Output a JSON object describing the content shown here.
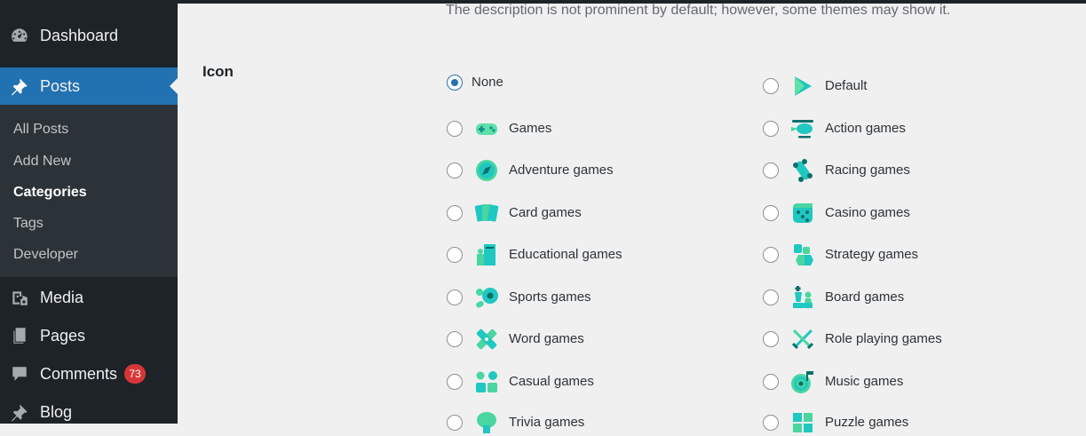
{
  "sidebar": {
    "dashboard": "Dashboard",
    "posts": "Posts",
    "submenu": [
      "All Posts",
      "Add New",
      "Categories",
      "Tags",
      "Developer"
    ],
    "media": "Media",
    "pages": "Pages",
    "comments": "Comments",
    "comments_count": "73",
    "blog": "Blog",
    "icons": {
      "dashboard": "gauge-icon",
      "posts": "pushpin-icon",
      "media": "media-icon",
      "pages": "pages-icon",
      "comments": "speech-bubble-icon",
      "blog": "pushpin-icon"
    }
  },
  "form": {
    "description_hint": "The description is not prominent by default; however, some themes may show it.",
    "icon_label": "Icon",
    "selected": "None",
    "options_left": [
      {
        "label": "None",
        "icon": ""
      },
      {
        "label": "Games",
        "icon": "gamepad-icon"
      },
      {
        "label": "Adventure games",
        "icon": "compass-icon"
      },
      {
        "label": "Card games",
        "icon": "cards-icon"
      },
      {
        "label": "Educational games",
        "icon": "book-icon"
      },
      {
        "label": "Sports games",
        "icon": "ball-icon"
      },
      {
        "label": "Word games",
        "icon": "letter-tiles-icon"
      },
      {
        "label": "Casual games",
        "icon": "blocks-icon"
      },
      {
        "label": "Trivia games",
        "icon": "brain-icon"
      }
    ],
    "options_right": [
      {
        "label": "Default",
        "icon": "play-triangle-icon"
      },
      {
        "label": "Action games",
        "icon": "helicopter-icon"
      },
      {
        "label": "Racing games",
        "icon": "race-car-icon"
      },
      {
        "label": "Casino games",
        "icon": "dice-icon"
      },
      {
        "label": "Strategy games",
        "icon": "chess-pieces-icon"
      },
      {
        "label": "Board games",
        "icon": "chess-king-pawn-icon"
      },
      {
        "label": "Role playing games",
        "icon": "crossed-swords-icon"
      },
      {
        "label": "Music games",
        "icon": "music-target-icon"
      },
      {
        "label": "Puzzle games",
        "icon": "puzzle-icon"
      }
    ]
  },
  "colors": {
    "accent": "#2271b1",
    "sidebar_bg": "#1d2327",
    "submenu_bg": "#2c3338",
    "badge": "#d63638",
    "icon_teal": "#1fc8c0",
    "icon_green": "#4ad6a0"
  }
}
